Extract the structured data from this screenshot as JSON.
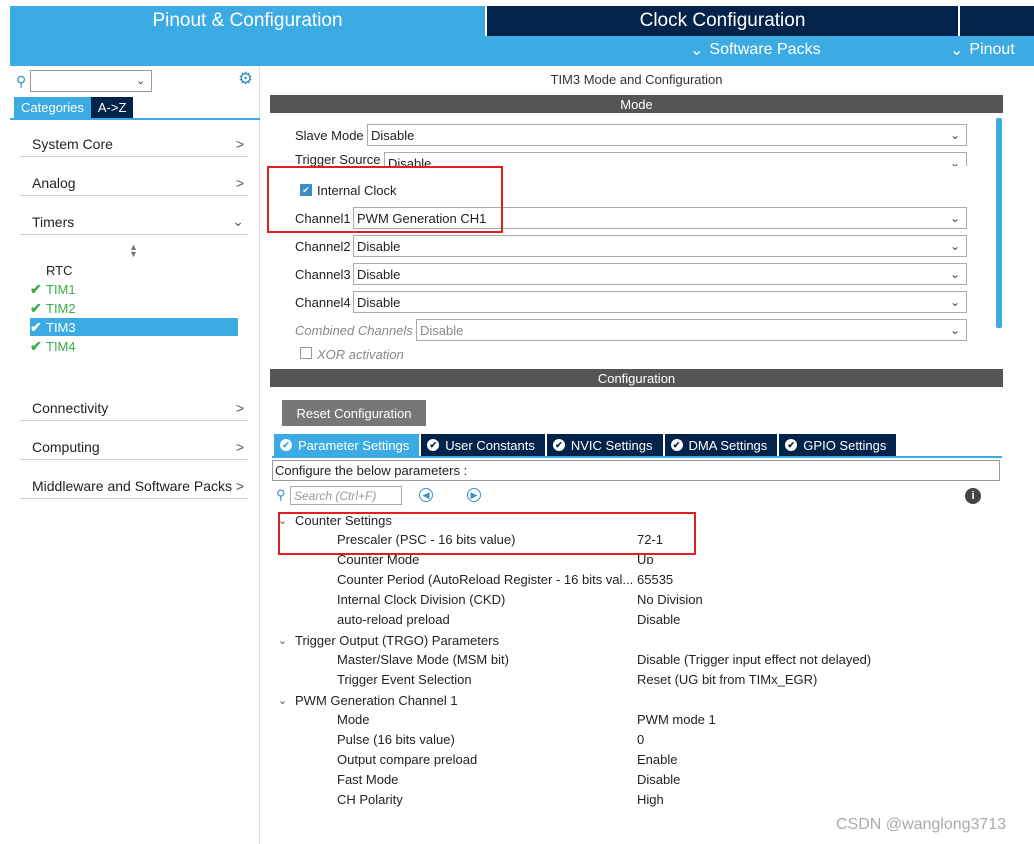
{
  "header": {
    "tabs": [
      "Pinout & Configuration",
      "Clock Configuration"
    ],
    "subnav": [
      "Software Packs",
      "Pinout"
    ]
  },
  "sidebar": {
    "search_value": "",
    "category_tabs": [
      "Categories",
      "A->Z"
    ],
    "categories": [
      "System Core",
      "Analog",
      "Timers",
      "Connectivity",
      "Computing",
      "Middleware and Software Packs"
    ],
    "timers": [
      {
        "label": "RTC",
        "checked": false,
        "selected": false
      },
      {
        "label": "TIM1",
        "checked": true,
        "selected": false
      },
      {
        "label": "TIM2",
        "checked": true,
        "selected": false
      },
      {
        "label": "TIM3",
        "checked": true,
        "selected": true
      },
      {
        "label": "TIM4",
        "checked": true,
        "selected": false
      }
    ]
  },
  "main": {
    "title": "TIM3 Mode and Configuration",
    "mode_header": "Mode",
    "mode": {
      "slave_mode": {
        "label": "Slave Mode",
        "value": "Disable"
      },
      "trigger_source": {
        "label": "Trigger Source",
        "value": "Disable"
      },
      "internal_clock": {
        "label": "Internal Clock",
        "checked": true
      },
      "channel1": {
        "label": "Channel1",
        "value": "PWM Generation CH1"
      },
      "channel2": {
        "label": "Channel2",
        "value": "Disable"
      },
      "channel3": {
        "label": "Channel3",
        "value": "Disable"
      },
      "channel4": {
        "label": "Channel4",
        "value": "Disable"
      },
      "combined": {
        "label": "Combined Channels",
        "value": "Disable"
      },
      "xor": {
        "label": "XOR activation",
        "checked": false
      }
    },
    "config_header": "Configuration",
    "reset_button": "Reset Configuration",
    "param_tabs": [
      "Parameter Settings",
      "User Constants",
      "NVIC Settings",
      "DMA Settings",
      "GPIO Settings"
    ],
    "info_text": "Configure the below parameters :",
    "search_placeholder": "Search (Ctrl+F)",
    "groups": [
      {
        "title": "Counter Settings",
        "params": [
          {
            "name": "Prescaler (PSC - 16 bits value)",
            "value": "72-1"
          },
          {
            "name": "Counter Mode",
            "value": "Up"
          },
          {
            "name": "Counter Period (AutoReload Register - 16 bits val...",
            "value": "65535"
          },
          {
            "name": "Internal Clock Division (CKD)",
            "value": "No Division"
          },
          {
            "name": "auto-reload preload",
            "value": "Disable"
          }
        ]
      },
      {
        "title": "Trigger Output (TRGO) Parameters",
        "params": [
          {
            "name": "Master/Slave Mode (MSM bit)",
            "value": "Disable (Trigger input effect not delayed)"
          },
          {
            "name": "Trigger Event Selection",
            "value": "Reset (UG bit from TIMx_EGR)"
          }
        ]
      },
      {
        "title": "PWM Generation Channel 1",
        "params": [
          {
            "name": "Mode",
            "value": "PWM mode 1"
          },
          {
            "name": "Pulse (16 bits value)",
            "value": "0"
          },
          {
            "name": "Output compare preload",
            "value": "Enable"
          },
          {
            "name": "Fast Mode",
            "value": "Disable"
          },
          {
            "name": "CH Polarity",
            "value": "High"
          }
        ]
      }
    ]
  },
  "watermark": "CSDN @wanglong3713",
  "colors": {
    "accent": "#3cabe3",
    "dark": "#03234b",
    "highlight": "#e02020"
  }
}
